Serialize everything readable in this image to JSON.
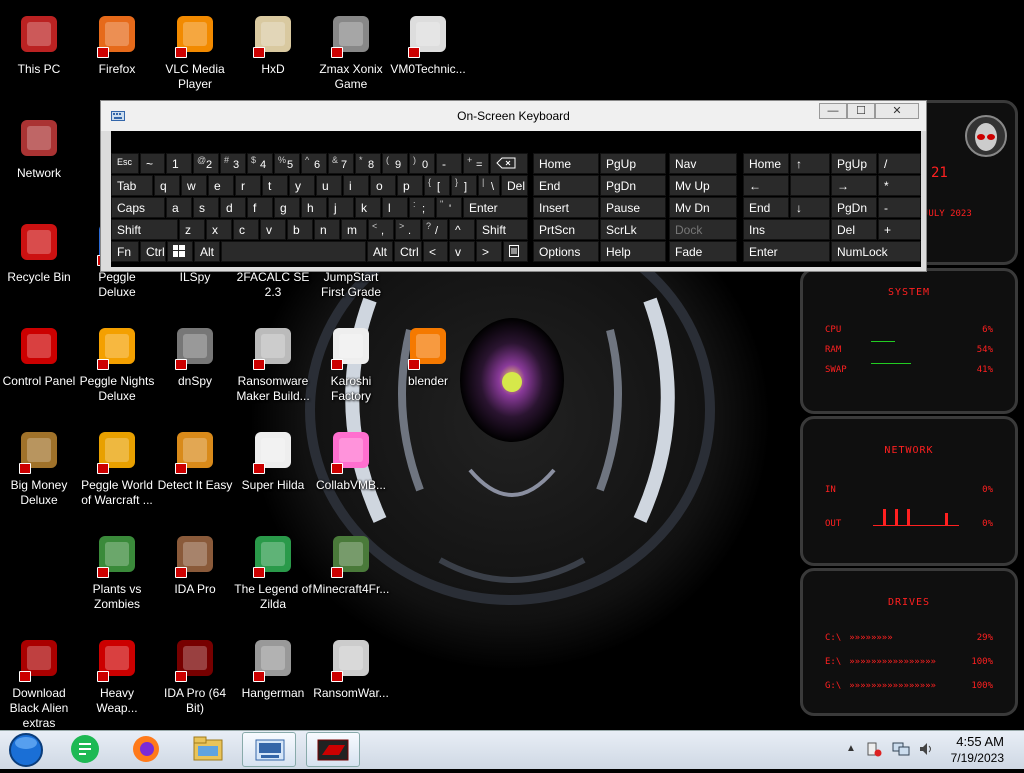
{
  "desktop": {
    "icons": [
      {
        "label": "This PC",
        "icon": "monitor-icon"
      },
      {
        "label": "Firefox",
        "icon": "firefox-icon"
      },
      {
        "label": "VLC Media Player",
        "icon": "vlc-cone-icon"
      },
      {
        "label": "HxD",
        "icon": "hxd-icon"
      },
      {
        "label": "Zmax Xonix Game",
        "icon": "game-icon"
      },
      {
        "label": "VM0Technic...",
        "icon": "doctor-icon"
      },
      {
        "label": "Network",
        "icon": "network-icon"
      },
      {
        "label": "Recycle Bin",
        "icon": "recycle-bin-icon"
      },
      {
        "label": "Peggle Deluxe",
        "icon": "peggle-icon"
      },
      {
        "label": "ILSpy",
        "icon": "ilspy-icon"
      },
      {
        "label": "2FACALC SE 2.3",
        "icon": "calc-icon"
      },
      {
        "label": "JumpStart First Grade",
        "icon": "jumpstart-icon"
      },
      {
        "label": "Control Panel",
        "icon": "control-panel-icon"
      },
      {
        "label": "Peggle Nights Deluxe",
        "icon": "peggle-nights-icon"
      },
      {
        "label": "dnSpy",
        "icon": "dnspy-icon"
      },
      {
        "label": "Ransomware Maker Build...",
        "icon": "ransomware-maker-icon"
      },
      {
        "label": "Karoshi Factory",
        "icon": "karoshi-icon"
      },
      {
        "label": "blender",
        "icon": "blender-icon"
      },
      {
        "label": "Big Money Deluxe",
        "icon": "money-bag-icon"
      },
      {
        "label": "Peggle World of Warcraft ...",
        "icon": "peggle-wow-icon"
      },
      {
        "label": "Detect It Easy",
        "icon": "die-icon"
      },
      {
        "label": "Super Hilda",
        "icon": "super-hilda-icon"
      },
      {
        "label": "CollabVMB...",
        "icon": "collabvm-icon"
      },
      {
        "label": "Plants vs Zombies",
        "icon": "pvz-icon"
      },
      {
        "label": "IDA Pro",
        "icon": "ida-icon"
      },
      {
        "label": "The Legend of Zilda",
        "icon": "zilda-icon"
      },
      {
        "label": "Minecraft4Fr...",
        "icon": "minecraft-icon"
      },
      {
        "label": "Download Black Alien extras",
        "icon": "alien-download-icon"
      },
      {
        "label": "Heavy Weap...",
        "icon": "radiation-icon"
      },
      {
        "label": "IDA Pro (64 Bit)",
        "icon": "ida64-icon"
      },
      {
        "label": "Hangerman",
        "icon": "hangerman-icon"
      },
      {
        "label": "RansomWar...",
        "icon": "skull-icon"
      }
    ]
  },
  "osk": {
    "title": "On-Screen Keyboard",
    "row1": [
      "Esc",
      "~",
      "1",
      "@",
      "2",
      "#",
      "3",
      "$",
      "4",
      "%",
      "5",
      "^",
      "6",
      "&",
      "7",
      "*",
      "8",
      "(",
      "9",
      ")",
      "0",
      "-",
      "+",
      "="
    ],
    "keys": {
      "tab": "Tab",
      "q": "q",
      "w": "w",
      "e": "e",
      "r": "r",
      "t": "t",
      "y": "y",
      "u": "u",
      "i": "i",
      "o": "o",
      "p": "p",
      "lbrace": "{",
      "lbracket": "[",
      "rbrace": "}",
      "rbracket": "]",
      "pipe": "|",
      "backslash": "\\",
      "del": "Del",
      "caps": "Caps",
      "a": "a",
      "s": "s",
      "d": "d",
      "f": "f",
      "g": "g",
      "h": "h",
      "j": "j",
      "k": "k",
      "l": "l",
      "colon": ":",
      "semicolon": ";",
      "quote": "\"",
      "apos": "'",
      "enter": "Enter",
      "shift": "Shift",
      "z": "z",
      "x": "x",
      "c": "c",
      "v": "v",
      "b": "b",
      "n": "n",
      "m": "m",
      "lt": "<",
      "comma": ",",
      "gt": ">",
      "period": ".",
      "question": "?",
      "slash": "/",
      "up": "^",
      "rshift": "Shift",
      "fn": "Fn",
      "ctrl": "Ctrl",
      "alt": "Alt",
      "ralt": "Alt",
      "rctrl": "Ctrl",
      "left": "<",
      "down": "v",
      "right": ">"
    },
    "nav": {
      "home": "Home",
      "pgup": "PgUp",
      "nav": "Nav",
      "end": "End",
      "pgdn": "PgDn",
      "mvup": "Mv Up",
      "insert": "Insert",
      "pause": "Pause",
      "mvdn": "Mv Dn",
      "prtscn": "PrtScn",
      "scrlk": "ScrLk",
      "dock": "Dock",
      "options": "Options",
      "help": "Help",
      "fade": "Fade"
    },
    "numpad": {
      "home": "Home",
      "up": "↑",
      "pgup": "PgUp",
      "div": "/",
      "left": "←",
      "right": "→",
      "mul": "*",
      "end": "End",
      "down": "↓",
      "pgdn": "PgDn",
      "minus": "-",
      "ins": "Ins",
      "del": "Del",
      "plus": "+",
      "enter": "Enter",
      "numlock": "NumLock"
    }
  },
  "widget": {
    "date": "JULY 2023",
    "day": "21",
    "system_title": "SYSTEM",
    "cpu_label": "CPU",
    "cpu_value": "6%",
    "ram_label": "RAM",
    "ram_value": "54%",
    "swap_label": "SWAP",
    "swap_value": "41%",
    "network_title": "NETWORK",
    "in_label": "IN",
    "in_value": "0%",
    "out_label": "OUT",
    "out_value": "0%",
    "drives_title": "DRIVES",
    "drives": [
      {
        "label": "C:\\",
        "value": "29%"
      },
      {
        "label": "E:\\",
        "value": "100%"
      },
      {
        "label": "G:\\",
        "value": "100%"
      }
    ]
  },
  "taskbar": {
    "time": "4:55 AM",
    "date": "7/19/2023"
  },
  "colors": {
    "accent_red": "#ff2020",
    "key_bg": "#2a2a2a",
    "taskbar": "#dfe6ef"
  }
}
